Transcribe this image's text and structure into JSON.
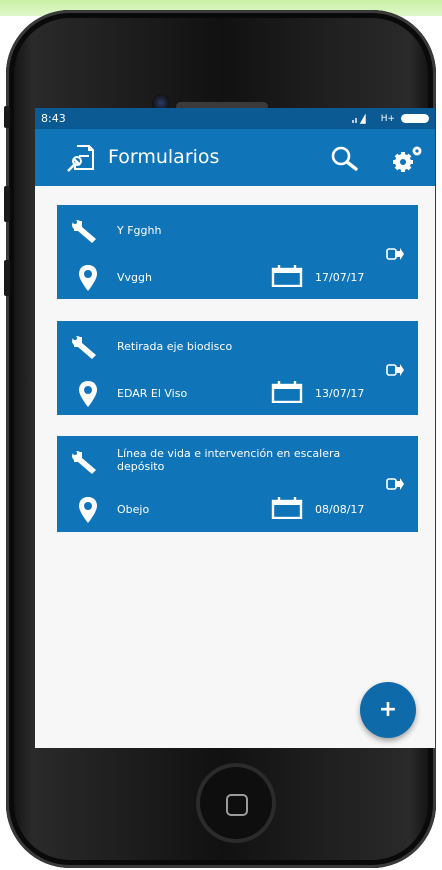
{
  "status_bar": {
    "time": "8:43",
    "network": "H+"
  },
  "app_bar": {
    "title": "Formularios"
  },
  "forms": [
    {
      "name": "Y Fgghh",
      "location": "Vvggh",
      "date": "17/07/17"
    },
    {
      "name": "Retirada eje biodisco",
      "location": "EDAR El Viso",
      "date": "13/07/17"
    },
    {
      "name": "Línea de vida e intervención en escalera depósito",
      "location": "Obejo",
      "date": "08/08/17"
    }
  ],
  "fab": {
    "label": "+"
  },
  "colors": {
    "primary": "#0f74b8",
    "status_bar": "#0b5a93",
    "background": "#f7f7f7"
  },
  "icons": [
    "form-logo-icon",
    "search-icon",
    "settings-gear-icon",
    "wrench-icon",
    "location-pin-icon",
    "calendar-icon",
    "send-icon",
    "plus-icon",
    "home-button-icon"
  ]
}
